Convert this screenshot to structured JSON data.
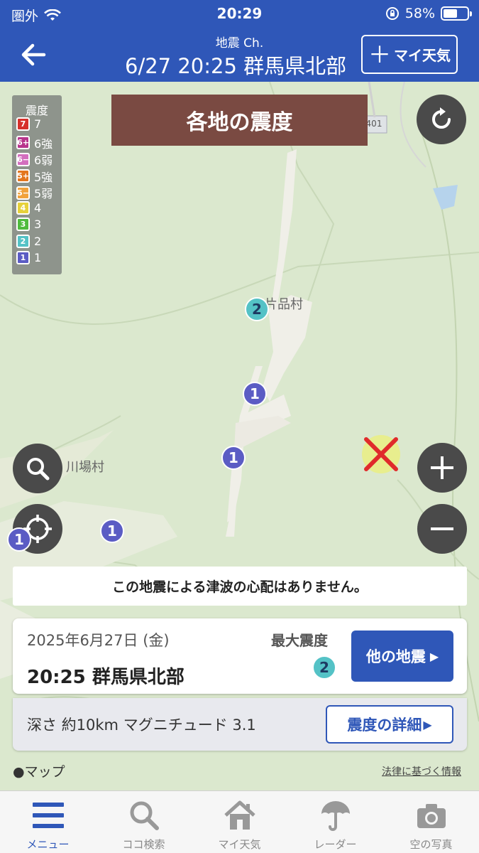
{
  "status": {
    "carrier": "圏外",
    "time": "20:29",
    "battery": "58%",
    "battery_level": 0.58
  },
  "header": {
    "sub": "地震 Ch.",
    "title": "6/27 20:25 群馬県北部",
    "my_weather": "マイ天気"
  },
  "map": {
    "banner": "各地の震度",
    "road_badge": "401",
    "legend": {
      "title": "震度",
      "items": [
        {
          "badge": "7",
          "label": "7",
          "color": "#d6302b"
        },
        {
          "badge": "6+",
          "label": "6強",
          "color": "#b8348c"
        },
        {
          "badge": "6−",
          "label": "6弱",
          "color": "#d36fbe"
        },
        {
          "badge": "5+",
          "label": "5強",
          "color": "#e3761e"
        },
        {
          "badge": "5−",
          "label": "5弱",
          "color": "#f1a23c"
        },
        {
          "badge": "4",
          "label": "4",
          "color": "#e6d13b"
        },
        {
          "badge": "3",
          "label": "3",
          "color": "#4fbb3e"
        },
        {
          "badge": "2",
          "label": "2",
          "color": "#54c2c6"
        },
        {
          "badge": "1",
          "label": "1",
          "color": "#5b5cc4"
        }
      ]
    },
    "places": {
      "katashina": "片品村",
      "kawaba": "川場村"
    },
    "markers": [
      "2",
      "1",
      "1",
      "1",
      "1"
    ]
  },
  "tsunami": "この地震による津波の心配はありません。",
  "info": {
    "date": "2025年6月27日 (金)",
    "quake": "20:25 群馬県北部",
    "max_label": "最大震度",
    "max_value": "2",
    "other_btn": "他の地震"
  },
  "depth": {
    "text": "深さ 約10km マグニチュード 3.1",
    "detail_btn": "震度の詳細"
  },
  "footer": {
    "maps": "マップ",
    "legal": "法律に基づく情報"
  },
  "tabs": [
    {
      "label": "メニュー",
      "icon": "menu-icon"
    },
    {
      "label": "ココ検索",
      "icon": "search-icon"
    },
    {
      "label": "マイ天気",
      "icon": "home-icon"
    },
    {
      "label": "レーダー",
      "icon": "umbrella-icon"
    },
    {
      "label": "空の写真",
      "icon": "camera-icon"
    }
  ],
  "colors": {
    "brand": "#2f57b8",
    "banner": "#7a4a42",
    "map_bg": "#d9e7cb"
  }
}
